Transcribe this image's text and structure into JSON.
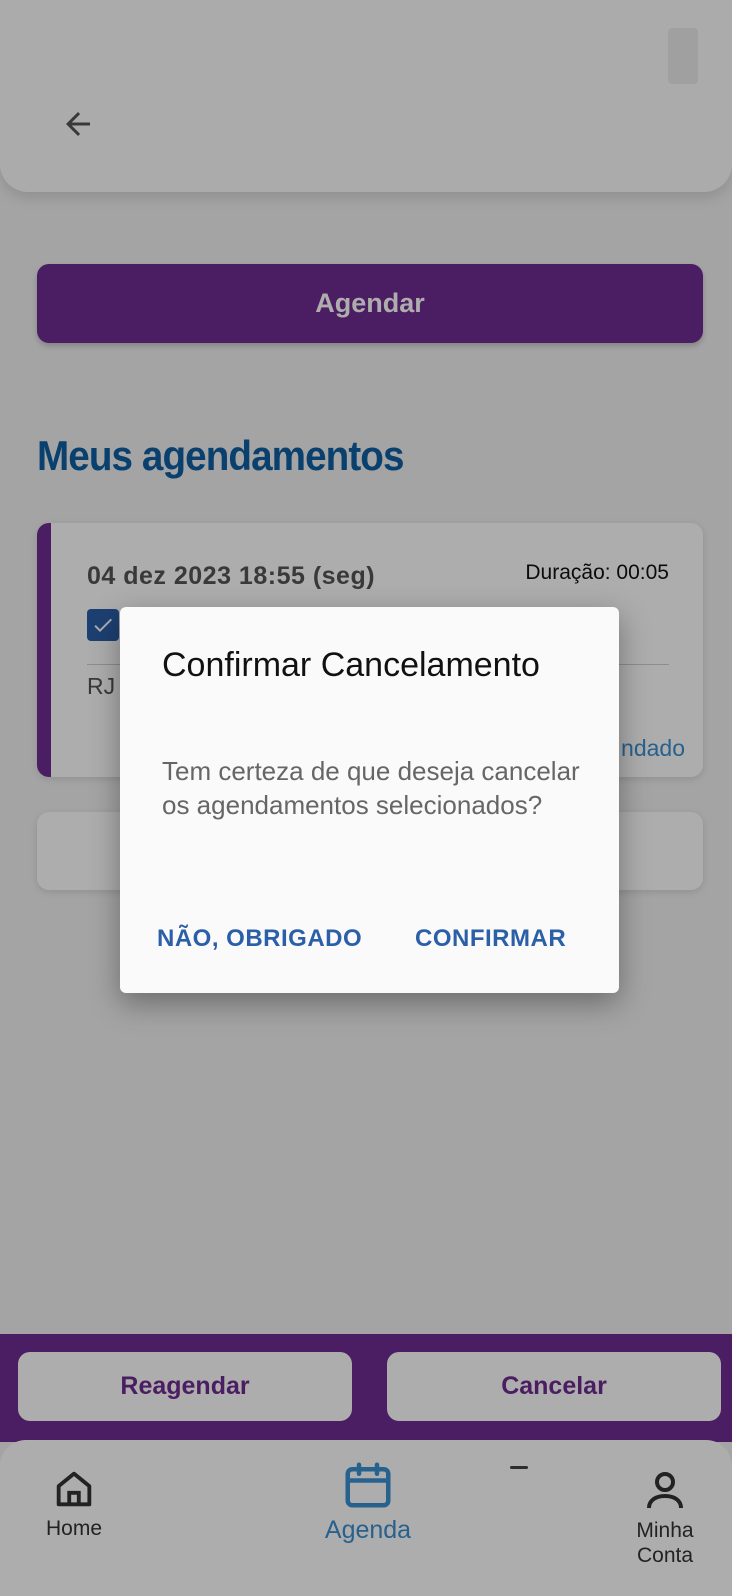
{
  "header": {
    "back_icon": "arrow-left-icon"
  },
  "primary_button": {
    "label": "Agendar"
  },
  "section": {
    "title": "Meus agendamentos"
  },
  "appointment": {
    "date": "04 dez 2023 18:55 (seg)",
    "duration": "Duração: 00:05",
    "location_prefix": "RJ",
    "status_partial": "ndado",
    "checked": true
  },
  "action_bar": {
    "reschedule_label": "Reagendar",
    "cancel_label": "Cancelar"
  },
  "bottom_nav": {
    "items": [
      {
        "label": "Home",
        "icon": "home-icon"
      },
      {
        "label": "Agenda",
        "icon": "calendar-icon",
        "active": true
      },
      {
        "label": "Minha\nConta",
        "icon": "user-icon"
      }
    ]
  },
  "dialog": {
    "title": "Confirmar Cancelamento",
    "message": "Tem certeza de que deseja cancelar os agendamentos selecionados?",
    "decline_label": "NÃO, OBRIGADO",
    "confirm_label": "CONFIRMAR"
  },
  "colors": {
    "brand_purple": "#6f2c91",
    "title_blue": "#0f5fa3",
    "link_blue": "#2b5fa8",
    "active_blue": "#3a8fd0"
  }
}
